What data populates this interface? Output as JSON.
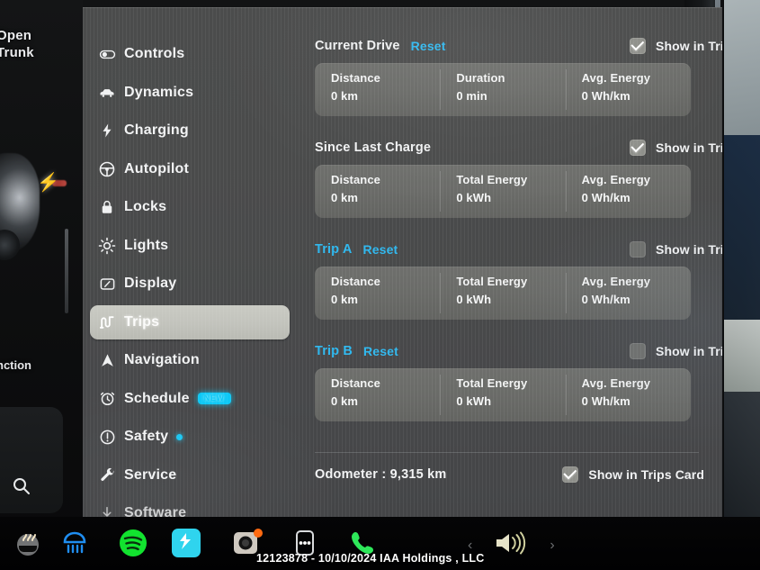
{
  "overlay": {
    "open_trunk_label": "Open\nTrunk",
    "function_label": "nction",
    "search_icon": "search-icon",
    "bolt_icon": "charge-bolt-icon"
  },
  "sidebar": {
    "items": [
      {
        "label": "Controls",
        "icon": "toggle-switch-icon",
        "selected": false,
        "dim": false
      },
      {
        "label": "Dynamics",
        "icon": "car-icon",
        "selected": false,
        "dim": false
      },
      {
        "label": "Charging",
        "icon": "bolt-icon",
        "selected": false,
        "dim": false
      },
      {
        "label": "Autopilot",
        "icon": "steering-wheel-icon",
        "selected": false,
        "dim": false
      },
      {
        "label": "Locks",
        "icon": "lock-icon",
        "selected": false,
        "dim": false
      },
      {
        "label": "Lights",
        "icon": "sun-brightness-icon",
        "selected": false,
        "dim": false
      },
      {
        "label": "Display",
        "icon": "display-icon",
        "selected": false,
        "dim": false
      },
      {
        "label": "Trips",
        "icon": "trips-icon",
        "selected": true,
        "dim": false
      },
      {
        "label": "Navigation",
        "icon": "navigation-arrow-icon",
        "selected": false,
        "dim": false
      },
      {
        "label": "Schedule",
        "icon": "alarm-clock-icon",
        "selected": false,
        "dim": false,
        "badge": "NEW"
      },
      {
        "label": "Safety",
        "icon": "warning-circle-icon",
        "selected": false,
        "dim": false,
        "dot": true
      },
      {
        "label": "Service",
        "icon": "wrench-icon",
        "selected": false,
        "dim": false
      },
      {
        "label": "Software",
        "icon": "download-arrow-icon",
        "selected": false,
        "dim": true
      }
    ]
  },
  "content": {
    "checkbox_label": "Show in Trips Card",
    "reset_label": "Reset",
    "sections": [
      {
        "title": "Current Drive",
        "title_is_link": false,
        "has_reset": true,
        "checked": true,
        "cells": [
          {
            "key": "Distance",
            "value": "0 km"
          },
          {
            "key": "Duration",
            "value": "0 min"
          },
          {
            "key": "Avg. Energy",
            "value": "0 Wh/km"
          }
        ]
      },
      {
        "title": "Since Last Charge",
        "title_is_link": false,
        "has_reset": false,
        "checked": true,
        "cells": [
          {
            "key": "Distance",
            "value": "0 km"
          },
          {
            "key": "Total Energy",
            "value": "0 kWh"
          },
          {
            "key": "Avg. Energy",
            "value": "0 Wh/km"
          }
        ]
      },
      {
        "title": "Trip A",
        "title_is_link": true,
        "has_reset": true,
        "checked": false,
        "cells": [
          {
            "key": "Distance",
            "value": "0 km"
          },
          {
            "key": "Total Energy",
            "value": "0 kWh"
          },
          {
            "key": "Avg. Energy",
            "value": "0 Wh/km"
          }
        ]
      },
      {
        "title": "Trip B",
        "title_is_link": true,
        "has_reset": true,
        "checked": false,
        "cells": [
          {
            "key": "Distance",
            "value": "0 km"
          },
          {
            "key": "Total Energy",
            "value": "0 kWh"
          },
          {
            "key": "Avg. Energy",
            "value": "0 Wh/km"
          }
        ]
      }
    ],
    "odometer": {
      "text": "Odometer :  9,315 km",
      "checkbox_label": "Show in Trips Card",
      "checked": true
    }
  },
  "taskbar": {
    "icons": [
      "seat-heater-icon",
      "rear-defrost-icon",
      "spotify-icon",
      "media-app-icon",
      "camera-icon",
      "more-options-icon",
      "phone-icon"
    ],
    "volume_prev": "‹",
    "volume_icon": "volume-speaker-icon",
    "volume_next": "›"
  },
  "watermark": {
    "text": "12123878 - 10/10/2024 IAA Holdings , LLC"
  },
  "colors": {
    "accent_blue": "#2fb8ef",
    "badge_cyan": "#0cc8f5",
    "panel_bg": "#4a4b4b",
    "card_bg": "#6a6b68",
    "selected_nav": "#c2c3bc"
  }
}
